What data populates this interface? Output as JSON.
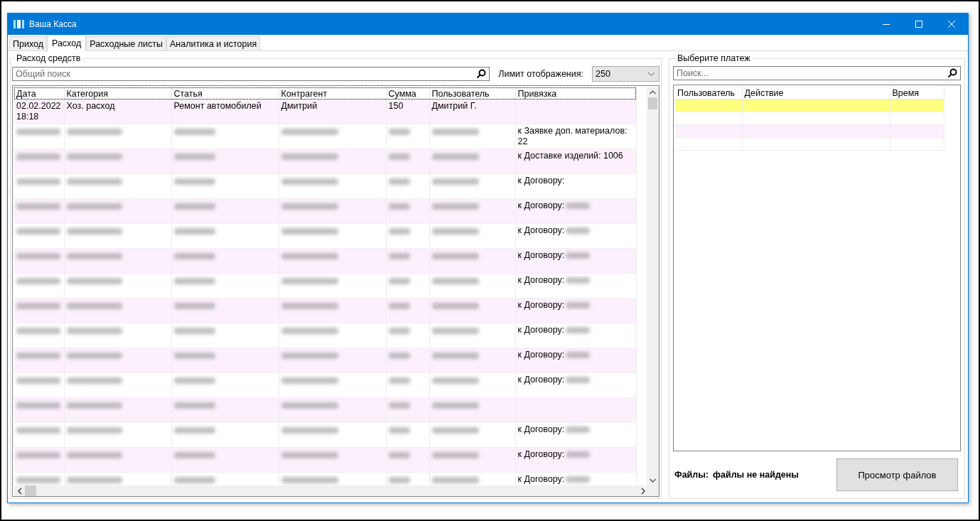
{
  "window": {
    "title": "Ваша Касса"
  },
  "tabs": [
    {
      "label": "Приход",
      "selected": false
    },
    {
      "label": "Расход",
      "selected": true
    },
    {
      "label": "Расходные листы",
      "selected": false
    },
    {
      "label": "Аналитика и история",
      "selected": false
    }
  ],
  "expense_panel": {
    "title": "Расход средств",
    "search": {
      "placeholder": "Общий поиск"
    },
    "limit": {
      "label": "Лимит отображения:",
      "value": "250"
    },
    "table": {
      "columns": [
        "Дата",
        "Категория",
        "Статья",
        "Контрагент",
        "Сумма",
        "Пользователь",
        "Привязка"
      ],
      "rows": [
        {
          "kind": "plain",
          "cells": [
            "02.02.2022\n18:18",
            "Хоз. расход",
            "Ремонт автомобилей",
            "Дмитрий",
            "150",
            "Дмитрий Г.",
            ""
          ]
        },
        {
          "kind": "redacted",
          "binding": "к Заявке доп. материалов: 22"
        },
        {
          "kind": "redacted",
          "binding": "к Доставке изделий: 1006"
        },
        {
          "kind": "redacted",
          "binding": "к Договору:"
        },
        {
          "kind": "redacted",
          "binding": "к Договору:"
        },
        {
          "kind": "redacted",
          "binding": "к Договору:"
        },
        {
          "kind": "redacted",
          "binding": "к Договору:"
        },
        {
          "kind": "redacted",
          "binding": "к Договору:"
        },
        {
          "kind": "redacted",
          "binding": "к Договору:"
        },
        {
          "kind": "redacted",
          "binding": "к Договору:"
        },
        {
          "kind": "redacted",
          "binding": "к Договору:"
        },
        {
          "kind": "redacted",
          "binding": "к Договору:"
        },
        {
          "kind": "redacted",
          "binding": ""
        },
        {
          "kind": "redacted",
          "binding": "к Договору:"
        },
        {
          "kind": "redacted",
          "binding": "к Договору:"
        },
        {
          "kind": "redacted",
          "binding": "к Договору:"
        }
      ]
    }
  },
  "payment_panel": {
    "title": "Выберите платеж",
    "search": {
      "placeholder": "Поиск..."
    },
    "table": {
      "columns": [
        "Пользователь",
        "Действие",
        "Время"
      ],
      "rows": [
        {
          "selected": true
        },
        {
          "selected": false
        },
        {
          "selected": false
        },
        {
          "selected": false
        }
      ]
    },
    "files": {
      "label": "Файлы:",
      "value": "файлы не найдены"
    },
    "view_button": "Просмотр файлов"
  }
}
